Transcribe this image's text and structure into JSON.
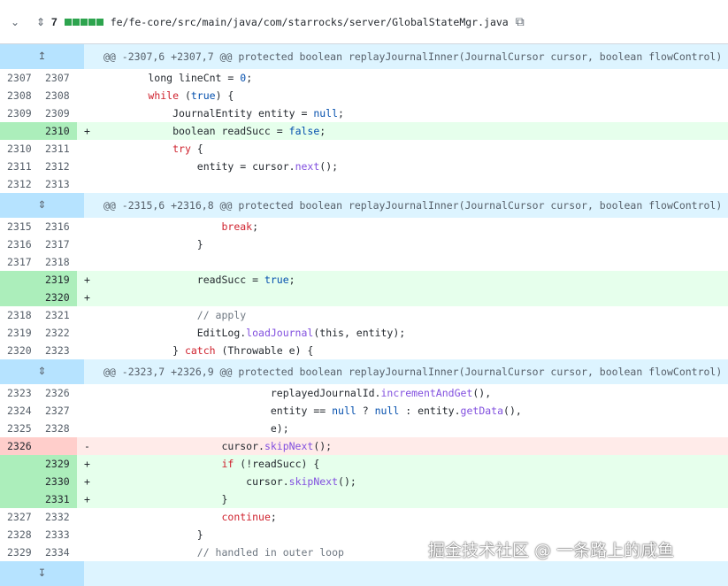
{
  "file": {
    "change_count": "7",
    "path": "fe/fe-core/src/main/java/com/starrocks/server/GlobalStateMgr.java",
    "diff_blocks": [
      "added",
      "added",
      "added",
      "added",
      "added"
    ]
  },
  "icons": {
    "collapse": "chevron-down-icon",
    "expand_all": "unfold-icon",
    "copy": "copy-icon",
    "expand_up": "expand-up-icon",
    "expand_both": "expand-both-icon",
    "expand_down": "expand-down-icon"
  },
  "hunks": [
    {
      "header": "@@ -2307,6 +2307,7 @@ protected boolean replayJournalInner(JournalCursor cursor, boolean flowControl)",
      "lines": [
        {
          "old": "2307",
          "new": "2307",
          "type": "ctx",
          "marker": "",
          "code": "        long lineCnt = 0;"
        },
        {
          "old": "2308",
          "new": "2308",
          "type": "ctx",
          "marker": "",
          "code": "        while (true) {"
        },
        {
          "old": "2309",
          "new": "2309",
          "type": "ctx",
          "marker": "",
          "code": "            JournalEntity entity = null;"
        },
        {
          "old": "",
          "new": "2310",
          "type": "add",
          "marker": "+",
          "code": "            boolean readSucc = false;"
        },
        {
          "old": "2310",
          "new": "2311",
          "type": "ctx",
          "marker": "",
          "code": "            try {"
        },
        {
          "old": "2311",
          "new": "2312",
          "type": "ctx",
          "marker": "",
          "code": "                entity = cursor.next();"
        },
        {
          "old": "2312",
          "new": "2313",
          "type": "ctx",
          "marker": "",
          "code": ""
        }
      ]
    },
    {
      "header": "@@ -2315,6 +2316,8 @@ protected boolean replayJournalInner(JournalCursor cursor, boolean flowControl)",
      "lines": [
        {
          "old": "2315",
          "new": "2316",
          "type": "ctx",
          "marker": "",
          "code": "                    break;"
        },
        {
          "old": "2316",
          "new": "2317",
          "type": "ctx",
          "marker": "",
          "code": "                }"
        },
        {
          "old": "2317",
          "new": "2318",
          "type": "ctx",
          "marker": "",
          "code": ""
        },
        {
          "old": "",
          "new": "2319",
          "type": "add",
          "marker": "+",
          "code": "                readSucc = true;"
        },
        {
          "old": "",
          "new": "2320",
          "type": "add",
          "marker": "+",
          "code": ""
        },
        {
          "old": "2318",
          "new": "2321",
          "type": "ctx",
          "marker": "",
          "code": "                // apply"
        },
        {
          "old": "2319",
          "new": "2322",
          "type": "ctx",
          "marker": "",
          "code": "                EditLog.loadJournal(this, entity);"
        },
        {
          "old": "2320",
          "new": "2323",
          "type": "ctx",
          "marker": "",
          "code": "            } catch (Throwable e) {"
        }
      ]
    },
    {
      "header": "@@ -2323,7 +2326,9 @@ protected boolean replayJournalInner(JournalCursor cursor, boolean flowControl)",
      "lines": [
        {
          "old": "2323",
          "new": "2326",
          "type": "ctx",
          "marker": "",
          "code": "                            replayedJournalId.incrementAndGet(),"
        },
        {
          "old": "2324",
          "new": "2327",
          "type": "ctx",
          "marker": "",
          "code": "                            entity == null ? null : entity.getData(),"
        },
        {
          "old": "2325",
          "new": "2328",
          "type": "ctx",
          "marker": "",
          "code": "                            e);"
        },
        {
          "old": "2326",
          "new": "",
          "type": "del",
          "marker": "-",
          "code": "                    cursor.skipNext();"
        },
        {
          "old": "",
          "new": "2329",
          "type": "add",
          "marker": "+",
          "code": "                    if (!readSucc) {"
        },
        {
          "old": "",
          "new": "2330",
          "type": "add",
          "marker": "+",
          "code": "                        cursor.skipNext();"
        },
        {
          "old": "",
          "new": "2331",
          "type": "add",
          "marker": "+",
          "code": "                    }"
        },
        {
          "old": "2327",
          "new": "2332",
          "type": "ctx",
          "marker": "",
          "code": "                    continue;"
        },
        {
          "old": "2328",
          "new": "2333",
          "type": "ctx",
          "marker": "",
          "code": "                }"
        },
        {
          "old": "2329",
          "new": "2334",
          "type": "ctx",
          "marker": "",
          "code": "                // handled in outer loop"
        }
      ]
    }
  ],
  "watermark": "掘金技术社区 @ 一条路上的咸鱼",
  "colors": {
    "add_bg": "#e6ffec",
    "add_num_bg": "#ccffd8",
    "del_bg": "#ffebe9",
    "del_num_bg": "#ffd7d5",
    "hunk_bg": "#ddf4ff",
    "hunk_btn_bg": "#b6e3ff"
  }
}
